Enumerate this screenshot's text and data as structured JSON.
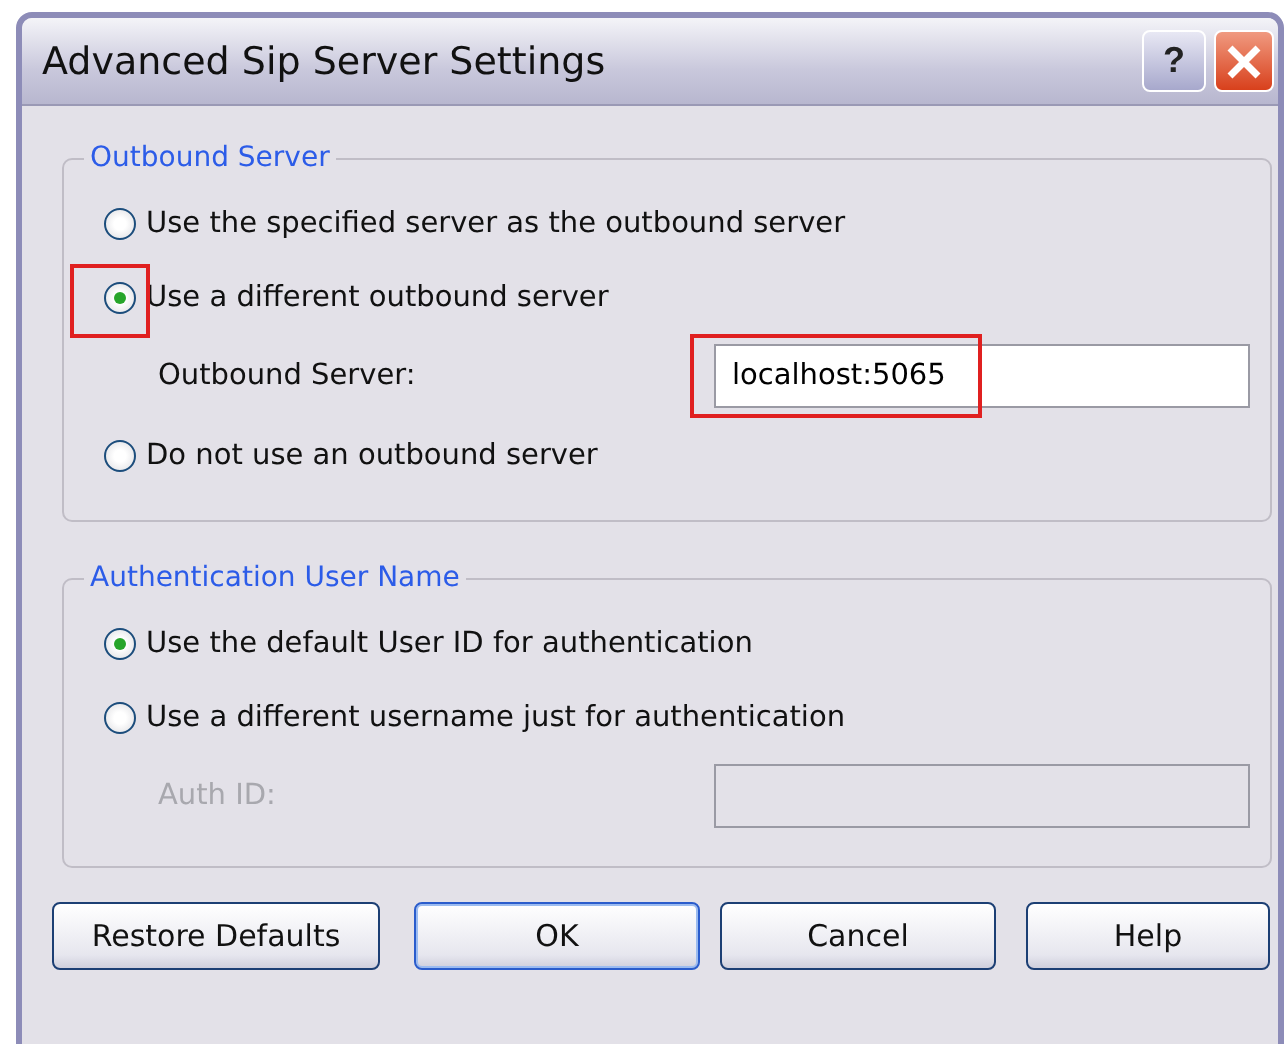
{
  "window": {
    "title": "Advanced Sip Server Settings",
    "help_button": "?"
  },
  "groups": [
    {
      "legend": "Outbound Server",
      "options": [
        {
          "label": "Use the specified server as the outbound server",
          "selected": false,
          "highlighted": false
        },
        {
          "label": "Use a different outbound server",
          "selected": true,
          "highlighted": true
        }
      ],
      "field": {
        "label": "Outbound Server:",
        "value": "localhost:5065",
        "disabled": false,
        "highlighted": true
      },
      "after_options": [
        {
          "label": "Do not use an outbound server",
          "selected": false,
          "highlighted": false
        }
      ]
    },
    {
      "legend": "Authentication User Name",
      "options": [
        {
          "label": "Use the default User ID for authentication",
          "selected": true,
          "highlighted": false
        },
        {
          "label": "Use a different username just for authentication",
          "selected": false,
          "highlighted": false
        }
      ],
      "field": {
        "label": "Auth ID:",
        "disabled": true
      }
    }
  ],
  "buttons": [
    {
      "label": "Restore Defaults",
      "default": false
    },
    {
      "label": "OK",
      "default": true
    },
    {
      "label": "Cancel",
      "default": false
    },
    {
      "label": "Help",
      "default": false
    }
  ]
}
